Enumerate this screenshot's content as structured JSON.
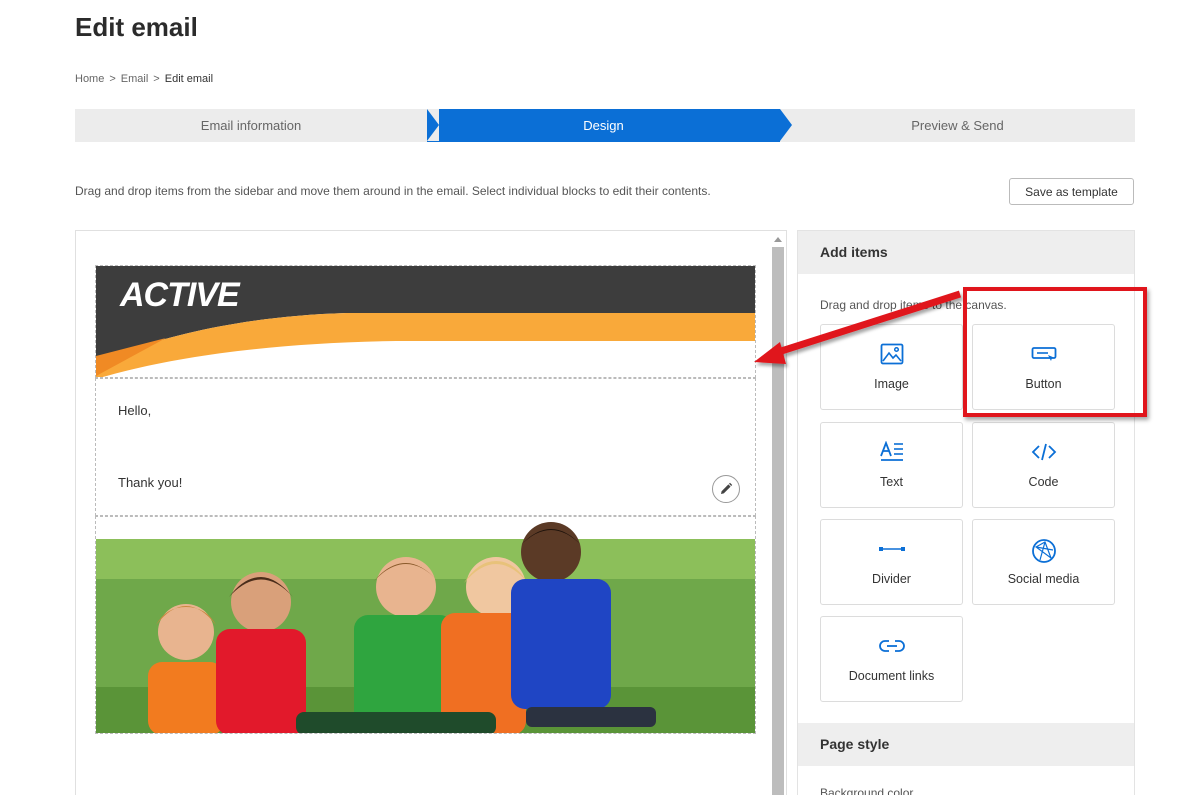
{
  "page": {
    "title": "Edit email"
  },
  "breadcrumb": {
    "home": "Home",
    "sep1": ">",
    "email": "Email",
    "sep2": ">",
    "current": "Edit email"
  },
  "steps": [
    {
      "label": "Email information",
      "state": "done"
    },
    {
      "label": "Design",
      "state": "active"
    },
    {
      "label": "Preview & Send",
      "state": "upcoming"
    }
  ],
  "instructions": "Drag and drop items from the sidebar and move them around in the email. Select individual blocks to edit their contents.",
  "save_template_label": "Save as template",
  "email": {
    "brand": "ACTIVE",
    "greeting": "Hello,",
    "signoff": "Thank you!"
  },
  "panel": {
    "add_items_title": "Add items",
    "hint": "Drag and drop items to the canvas.",
    "items": [
      {
        "label": "Image",
        "icon": "image-icon"
      },
      {
        "label": "Button",
        "icon": "button-icon"
      },
      {
        "label": "Text",
        "icon": "text-icon"
      },
      {
        "label": "Code",
        "icon": "code-icon"
      },
      {
        "label": "Divider",
        "icon": "divider-icon"
      },
      {
        "label": "Social media",
        "icon": "social-media-icon"
      },
      {
        "label": "Document links",
        "icon": "link-icon"
      }
    ],
    "page_style_title": "Page style",
    "background_color_label": "Background color"
  },
  "colors": {
    "accent_blue": "#0b6fd6",
    "annotation_red": "#e0151c",
    "brand_orange": "#f9a93a",
    "brand_dark": "#3d3d3d"
  }
}
